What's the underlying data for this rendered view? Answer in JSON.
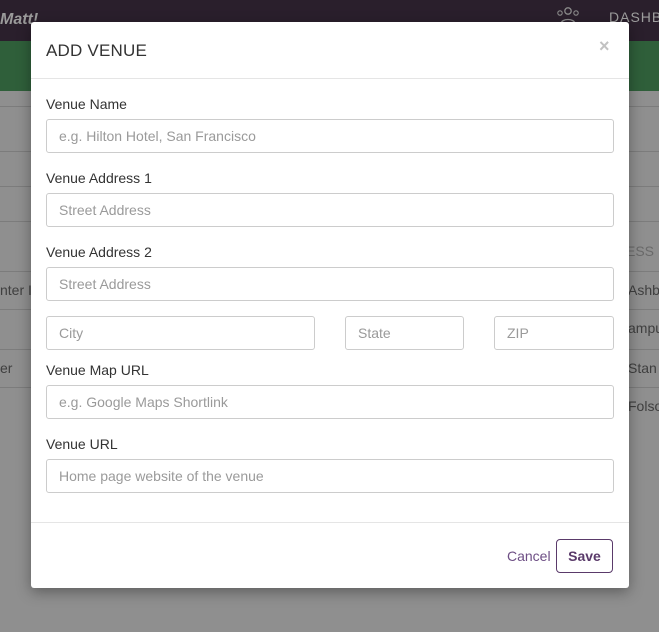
{
  "background": {
    "greeting_fragment": "Matt!",
    "dashboard_fragment": "DASHB",
    "column_fragment": "ESS",
    "left_rows": [
      "nter I",
      "er"
    ],
    "right_rows": [
      "Ashby",
      "ampu",
      "Stan",
      "Folso"
    ]
  },
  "modal": {
    "title": "ADD VENUE",
    "close_symbol": "×",
    "fields": {
      "venue_name": {
        "label": "Venue Name",
        "placeholder": "e.g. Hilton Hotel, San Francisco"
      },
      "address1": {
        "label": "Venue Address 1",
        "placeholder": "Street Address"
      },
      "address2": {
        "label": "Venue Address 2",
        "placeholder": "Street Address"
      },
      "city": {
        "placeholder": "City"
      },
      "state": {
        "placeholder": "State"
      },
      "zip": {
        "placeholder": "ZIP"
      },
      "map_url": {
        "label": "Venue Map URL",
        "placeholder": "e.g. Google Maps Shortlink"
      },
      "venue_url": {
        "label": "Venue URL",
        "placeholder": "Home page website of the venue"
      }
    },
    "footer": {
      "cancel_label": "Cancel",
      "save_label": "Save"
    }
  },
  "colors": {
    "accent_purple": "#5a3a6a",
    "topbar_dark": "#2a1f2c",
    "green_bar": "#2f5f3a"
  },
  "icons": [
    "people-icon",
    "close-icon"
  ]
}
